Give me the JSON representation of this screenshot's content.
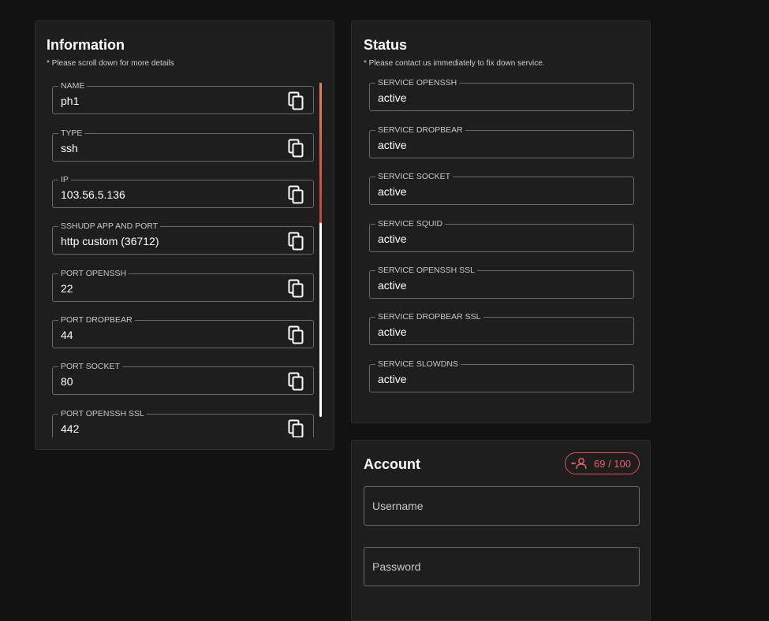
{
  "information": {
    "title": "Information",
    "subtitle": "* Please scroll down for more details",
    "fields": [
      {
        "label": "NAME",
        "value": "ph1"
      },
      {
        "label": "TYPE",
        "value": "ssh"
      },
      {
        "label": "IP",
        "value": "103.56.5.136"
      },
      {
        "label": "SSHUDP APP AND PORT",
        "value": "http custom (36712)"
      },
      {
        "label": "PORT OPENSSH",
        "value": "22"
      },
      {
        "label": "PORT DROPBEAR",
        "value": "44"
      },
      {
        "label": "PORT SOCKET",
        "value": "80"
      },
      {
        "label": "PORT OPENSSH SSL",
        "value": "442"
      }
    ],
    "copy_icon": "copy-icon"
  },
  "status": {
    "title": "Status",
    "subtitle": "* Please contact us immediately to fix down service.",
    "services": [
      {
        "label": "SERVICE OPENSSH",
        "value": "active"
      },
      {
        "label": "SERVICE DROPBEAR",
        "value": "active"
      },
      {
        "label": "SERVICE SOCKET",
        "value": "active"
      },
      {
        "label": "SERVICE SQUID",
        "value": "active"
      },
      {
        "label": "SERVICE OPENSSH SSL",
        "value": "active"
      },
      {
        "label": "SERVICE DROPBEAR SSL",
        "value": "active"
      },
      {
        "label": "SERVICE SLOWDNS",
        "value": "active"
      }
    ]
  },
  "account": {
    "title": "Account",
    "badge": "69 / 100",
    "badge_icon": "users-connected-icon",
    "username_placeholder": "Username",
    "password_placeholder": "Password"
  },
  "colors": {
    "background": "#121212",
    "card": "#1e1e1e",
    "accent_red": "#e05151",
    "scroll_gradient": [
      "#e2874f",
      "#d23a3a"
    ]
  }
}
